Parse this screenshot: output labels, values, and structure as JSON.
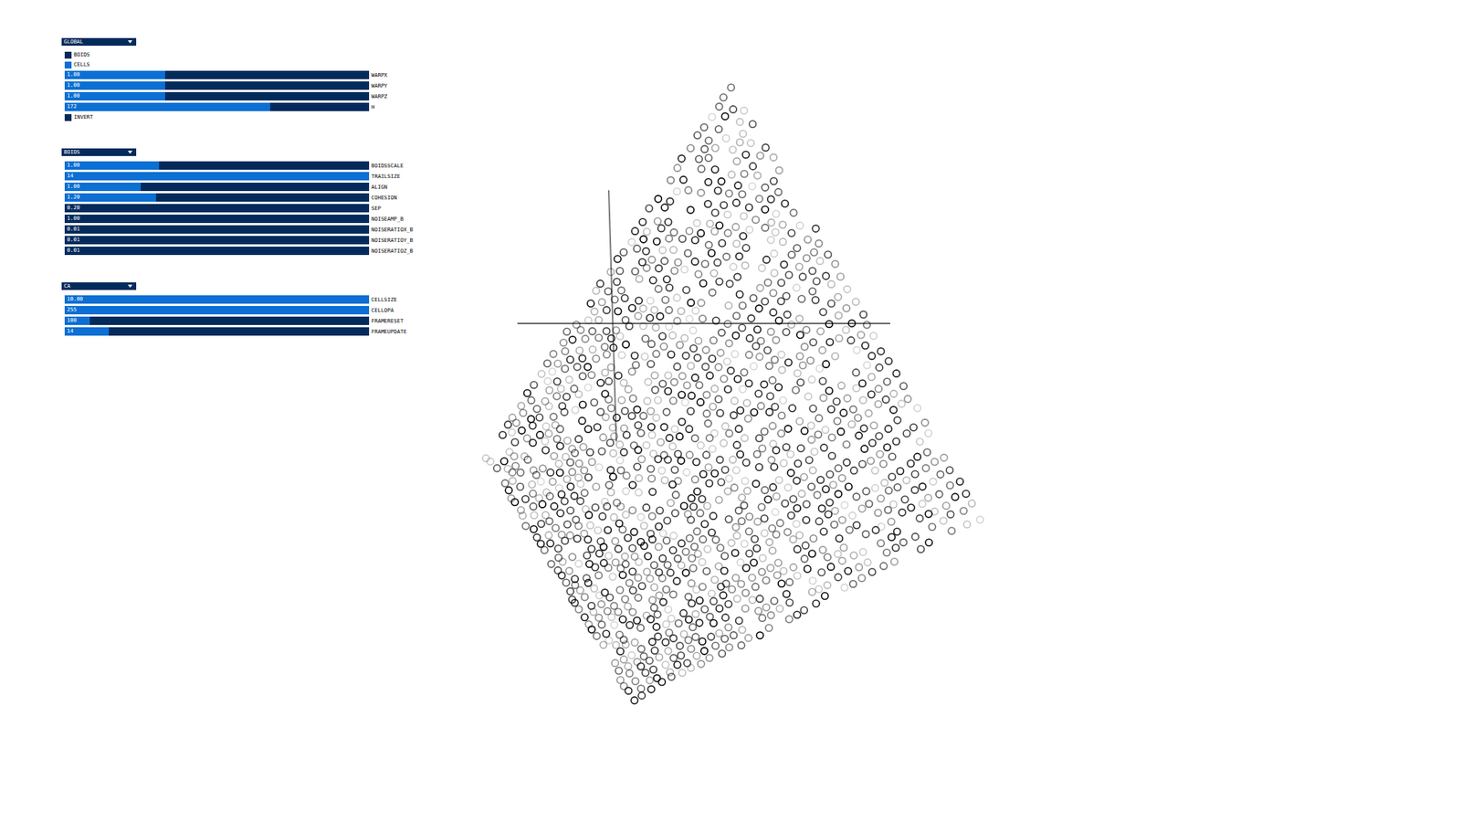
{
  "groups": [
    {
      "title": "GLOBAL",
      "expanded": true,
      "controls": [
        {
          "kind": "toggle",
          "label": "BOIDS",
          "on": false
        },
        {
          "kind": "toggle",
          "label": "CELLS",
          "on": true
        },
        {
          "kind": "slider",
          "label": "WARPX",
          "value": "1.00",
          "level": 0.33
        },
        {
          "kind": "slider",
          "label": "WARPY",
          "value": "1.00",
          "level": 0.33
        },
        {
          "kind": "slider",
          "label": "WARPZ",
          "value": "1.00",
          "level": 0.33
        },
        {
          "kind": "slider",
          "label": "H",
          "value": "172",
          "level": 0.676
        },
        {
          "kind": "toggle",
          "label": "INVERT",
          "on": false
        }
      ]
    },
    {
      "title": "BOIDS",
      "expanded": true,
      "controls": [
        {
          "kind": "slider",
          "label": "BOIDSSCALE",
          "value": "1.00",
          "level": 0.31
        },
        {
          "kind": "slider",
          "label": "TRAILSIZE",
          "value": "14",
          "level": 1
        },
        {
          "kind": "slider",
          "label": "ALIGN",
          "value": "1.00",
          "level": 0.25
        },
        {
          "kind": "slider",
          "label": "COHESION",
          "value": "1.20",
          "level": 0.3
        },
        {
          "kind": "slider",
          "label": "SEP",
          "value": "0.20",
          "level": 0
        },
        {
          "kind": "slider",
          "label": "NOISEAMP_B",
          "value": "1.00",
          "level": 0
        },
        {
          "kind": "slider",
          "label": "NOISERATIOX_B",
          "value": "0.01",
          "level": 0
        },
        {
          "kind": "slider",
          "label": "NOISERATIOY_B",
          "value": "0.01",
          "level": 0
        },
        {
          "kind": "slider",
          "label": "NOISERATIOZ_B",
          "value": "0.01",
          "level": 0
        }
      ]
    },
    {
      "title": "CA",
      "expanded": true,
      "controls": [
        {
          "kind": "slider",
          "label": "CELLSIZE",
          "value": "10.00",
          "level": 1
        },
        {
          "kind": "slider",
          "label": "CELLOPA",
          "value": "255",
          "level": 1
        },
        {
          "kind": "slider",
          "label": "FRAMERESET",
          "value": "100",
          "level": 0.083
        },
        {
          "kind": "slider",
          "label": "FRAMEUPDATE",
          "value": "14",
          "level": 0.144
        }
      ]
    }
  ]
}
